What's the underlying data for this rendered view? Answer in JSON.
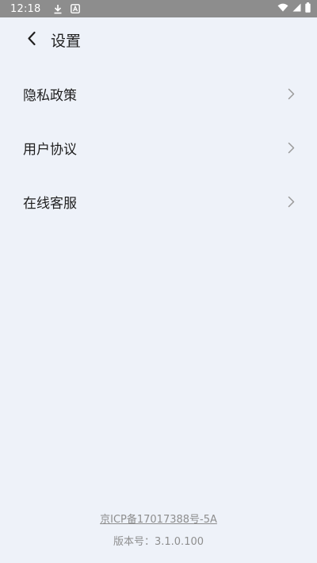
{
  "status_bar": {
    "time": "12:18",
    "icons": [
      "download-icon",
      "a-badge-icon",
      "wifi-icon",
      "signal-icon",
      "battery-icon"
    ]
  },
  "header": {
    "title": "设置",
    "back_icon": "chevron-left-icon"
  },
  "menu": {
    "items": [
      {
        "label": "隐私政策"
      },
      {
        "label": "用户协议"
      },
      {
        "label": "在线客服"
      }
    ],
    "chevron_icon": "chevron-right-icon"
  },
  "footer": {
    "icp_text": "京ICP备17017388号-5A",
    "version_label": "版本号：",
    "version_value": "3.1.0.100"
  },
  "colors": {
    "background": "#eef2f9",
    "status_bar": "#8d8d8d",
    "text_primary": "#1e1e1e",
    "text_secondary": "#8e8e8e"
  }
}
